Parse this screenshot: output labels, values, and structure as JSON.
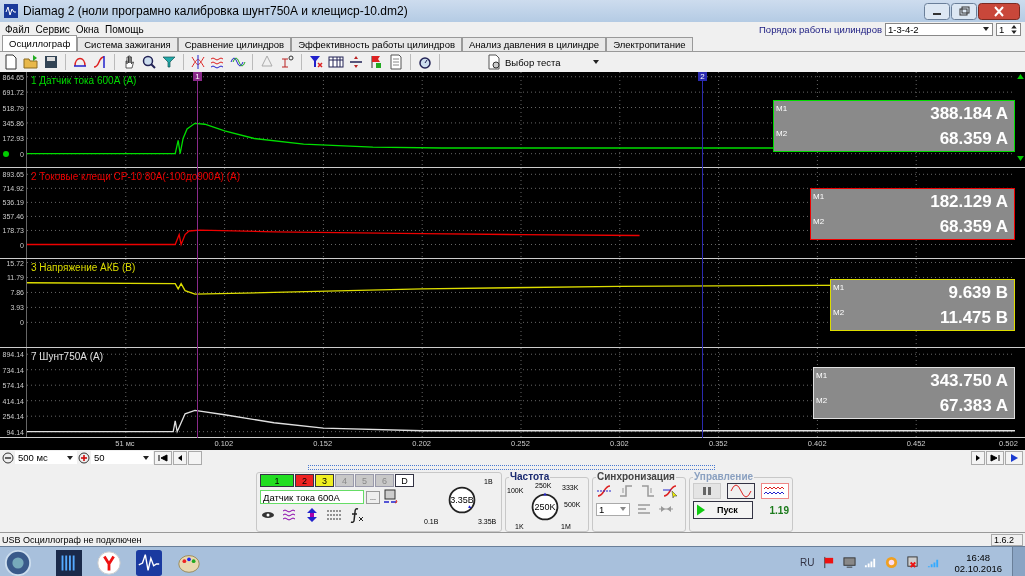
{
  "window": {
    "title": "Diamag 2 (ноли програмно калибровка шунт750А и клещиср-10.dm2)"
  },
  "menu": [
    "Файл",
    "Сервис",
    "Окна",
    "Помощь"
  ],
  "cylinder_order": {
    "label": "Порядок работы цилиндров",
    "value": "1-3-4-2",
    "cylinder": "1"
  },
  "tabs": [
    {
      "label": "Осциллограф",
      "selected": true
    },
    {
      "label": "Система зажигания",
      "selected": false
    },
    {
      "label": "Сравнение цилиндров",
      "selected": false
    },
    {
      "label": "Эффективность работы цилиндров",
      "selected": false
    },
    {
      "label": "Анализ давления в цилиндре",
      "selected": false
    },
    {
      "label": "Электропитание",
      "selected": false
    }
  ],
  "toolbar": {
    "test_select": "Выбор теста"
  },
  "cursors": [
    {
      "label": "1",
      "color": "#8a2a8a"
    },
    {
      "label": "2",
      "color": "#2a2ab0"
    }
  ],
  "channels": [
    {
      "name": "1 Датчик тока 600А (А)",
      "color": "#00dd00",
      "yticks": [
        "864.65",
        "691.72",
        "518.79",
        "345.86",
        "172.93",
        "0"
      ],
      "m1_label": "M1",
      "m1": "388.184 A",
      "m2_label": "M2",
      "m2": "68.359 A"
    },
    {
      "name": "2 Токовые клещи CP-10 80A(-100до900A) (A)",
      "color": "#ee0000",
      "yticks": [
        "893.65",
        "714.92",
        "536.19",
        "357.46",
        "178.73",
        "0"
      ],
      "m1_label": "M1",
      "m1": "182.129 A",
      "m2_label": "M2",
      "m2": "68.359 A"
    },
    {
      "name": "3 Напряжение АКБ (В)",
      "color": "#dddd00",
      "yticks": [
        "15.72",
        "11.79",
        "7.86",
        "3.93",
        "0"
      ],
      "m1_label": "M1",
      "m1": "9.639 B",
      "m2_label": "M2",
      "m2": "11.475 B"
    },
    {
      "name": "7 Шунт750А (А)",
      "color": "#e0e0e0",
      "yticks": [
        "894.14",
        "734.14",
        "574.14",
        "414.14",
        "254.14",
        "94.14"
      ],
      "m1_label": "M1",
      "m1": "343.750 A",
      "m2_label": "M2",
      "m2": "67.383 A"
    }
  ],
  "x_axis": [
    "51 мс",
    "0.102",
    "0.152",
    "0.202",
    "0.252",
    "0.302",
    "0.352",
    "0.402",
    "0.452",
    "0.502"
  ],
  "timebase": {
    "scale": "500 мс",
    "zoom": "50"
  },
  "channel_buttons": [
    {
      "label": "1",
      "color": "#22dd22",
      "disabled": false
    },
    {
      "label": "2",
      "color": "#ee2222",
      "disabled": false
    },
    {
      "label": "3",
      "color": "#eeee22",
      "disabled": false
    },
    {
      "label": "4",
      "color": "#c8c8c8",
      "disabled": true
    },
    {
      "label": "5",
      "color": "#c8c8c8",
      "disabled": true
    },
    {
      "label": "6",
      "color": "#c8c8c8",
      "disabled": true
    },
    {
      "label": "D",
      "color": "#ffffff",
      "disabled": false
    }
  ],
  "channel_settings": {
    "name": "Датчик тока 600А",
    "more": "...",
    "knob_value": "3.35В",
    "knob_labels": [
      "1В",
      "0.1В",
      "3.35В"
    ]
  },
  "frequency": {
    "title": "Частота",
    "value": "250K",
    "labels": [
      "250K",
      "100K",
      "333K",
      "500K",
      "1K",
      "1M"
    ]
  },
  "sync": {
    "title": "Синхронизация",
    "channel": "1"
  },
  "control": {
    "title": "Управление",
    "start": "Пуск",
    "version": "1.19"
  },
  "status_bar": {
    "message": "USB Осциллограф не подключен",
    "version": "1.6.2"
  },
  "taskbar": {
    "language": "RU",
    "time": "16:48",
    "date": "02.10.2016"
  }
}
